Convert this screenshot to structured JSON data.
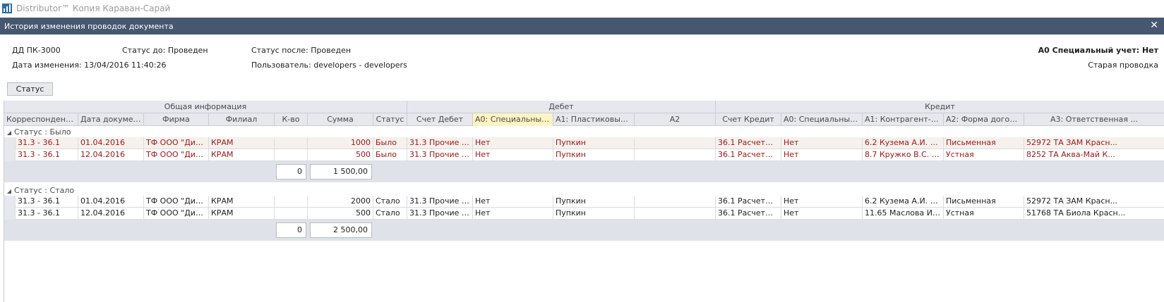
{
  "app": {
    "title": "Distributor™ Копия Караван-Сарай"
  },
  "dialog": {
    "title": "История изменения проводок документа",
    "close": "✕"
  },
  "info": {
    "doc": "ДД ПК-3000",
    "status_before": "Статус до: Проведен",
    "status_after": "Статус после: Проведен",
    "special": "А0 Специальный учет: Нет",
    "change_date": "Дата изменения: 13/04/2016 11:40:26",
    "user": "Пользователь: developers - developers",
    "old_posting": "Старая проводка"
  },
  "toolbar": {
    "status_button": "Статус"
  },
  "grid": {
    "bands": [
      "Общая информация",
      "Дебет",
      "Кредит"
    ],
    "columns": [
      "Корреспонденция ...",
      "Дата документа",
      "Фирма",
      "Филиал",
      "К-во",
      "Сумма",
      "Статус",
      "Счет Дебет",
      "А0: Специальный учет",
      "А1: Пластиковые ка...",
      "А2",
      "Счет Кредит",
      "А0: Специальный учет",
      "А1: Контрагент-Кли...",
      "А2: Форма договоре...",
      "А3: Ответственная ..."
    ],
    "groups": [
      {
        "label": "Статус : Было",
        "rows": [
          [
            "31.3 - 36.1",
            "01.04.2016",
            "ТФ ООО \"Дистр...",
            "КРАМ",
            "",
            "1000",
            "Было",
            "31.3 Прочие сч...",
            "Нет",
            "Пупкин",
            "",
            "36.1 Расчеты с ...",
            "Нет",
            "6.2 Кузема А.И. СП...",
            "Письменная",
            "52972 ТА ЗАМ Красн..."
          ],
          [
            "31.3 - 36.1",
            "12.04.2016",
            "ТФ ООО \"Дистр...",
            "КРАМ",
            "",
            "500",
            "Было",
            "31.3 Прочие сч...",
            "Нет",
            "Пупкин",
            "",
            "36.1 Расчеты с ...",
            "Нет",
            "8.7  Кружко В.С. СП...",
            "Устная",
            "8252 ТА Аква-Май К..."
          ]
        ],
        "total_qty": "0",
        "total_sum": "1 500,00"
      },
      {
        "label": "Статус : Стало",
        "rows": [
          [
            "31.3 - 36.1",
            "01.04.2016",
            "ТФ ООО \"Дистр...",
            "КРАМ",
            "",
            "2000",
            "Стало",
            "31.3 Прочие сч...",
            "Нет",
            "Пупкин",
            "",
            "36.1 Расчеты с ...",
            "Нет",
            "6.2 Кузема А.И. СП...",
            "Письменная",
            "52972 ТА ЗАМ Красн..."
          ],
          [
            "31.3 - 36.1",
            "12.04.2016",
            "ТФ ООО \"Дистр...",
            "КРАМ",
            "",
            "500",
            "Стало",
            "31.3 Прочие сч...",
            "Нет",
            "Пупкин",
            "",
            "36.1 Расчеты с ...",
            "Нет",
            "11.65  Маслова И.И....",
            "Устная",
            "51768 ТА Биола Красн..."
          ]
        ],
        "total_qty": "0",
        "total_sum": "2 500,00"
      }
    ]
  }
}
